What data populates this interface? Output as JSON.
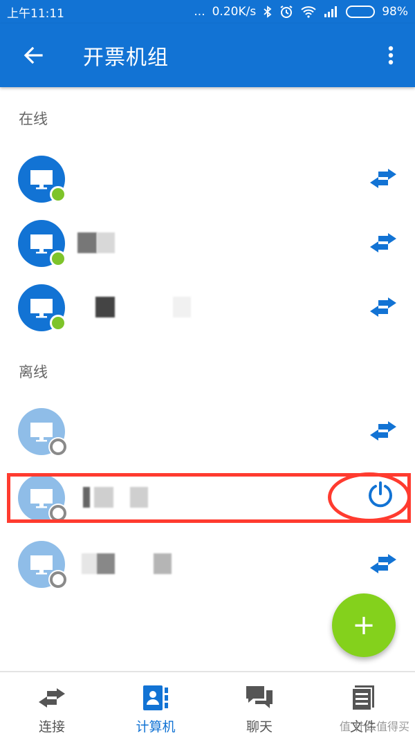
{
  "status_bar": {
    "time": "上午11:11",
    "dots": "...",
    "speed": "0.20K/s",
    "battery": "98%",
    "battery_level": 0.98
  },
  "app_bar": {
    "title": "开票机组"
  },
  "sections": {
    "online_label": "在线",
    "offline_label": "离线"
  },
  "devices": {
    "online": [
      {
        "status": "online"
      },
      {
        "status": "online"
      },
      {
        "status": "online"
      }
    ],
    "offline": [
      {
        "status": "offline",
        "action": "connect"
      },
      {
        "status": "offline",
        "action": "power",
        "highlighted": true
      },
      {
        "status": "offline",
        "action": "connect"
      }
    ]
  },
  "fab": {
    "label": "+"
  },
  "bottom_nav": {
    "tabs": [
      {
        "label": "连接",
        "icon": "swap-arrows-icon",
        "active": false
      },
      {
        "label": "计算机",
        "icon": "contacts-icon",
        "active": true
      },
      {
        "label": "聊天",
        "icon": "chat-icon",
        "active": false
      },
      {
        "label": "文件",
        "icon": "file-icon",
        "active": false
      }
    ]
  },
  "watermark": "值 什么值得买",
  "colors": {
    "primary": "#1273d4",
    "online_dot": "#7ec42a",
    "offline_avatar": "#8fbde8",
    "fab": "#84d11c",
    "highlight": "#ff3b2f"
  }
}
